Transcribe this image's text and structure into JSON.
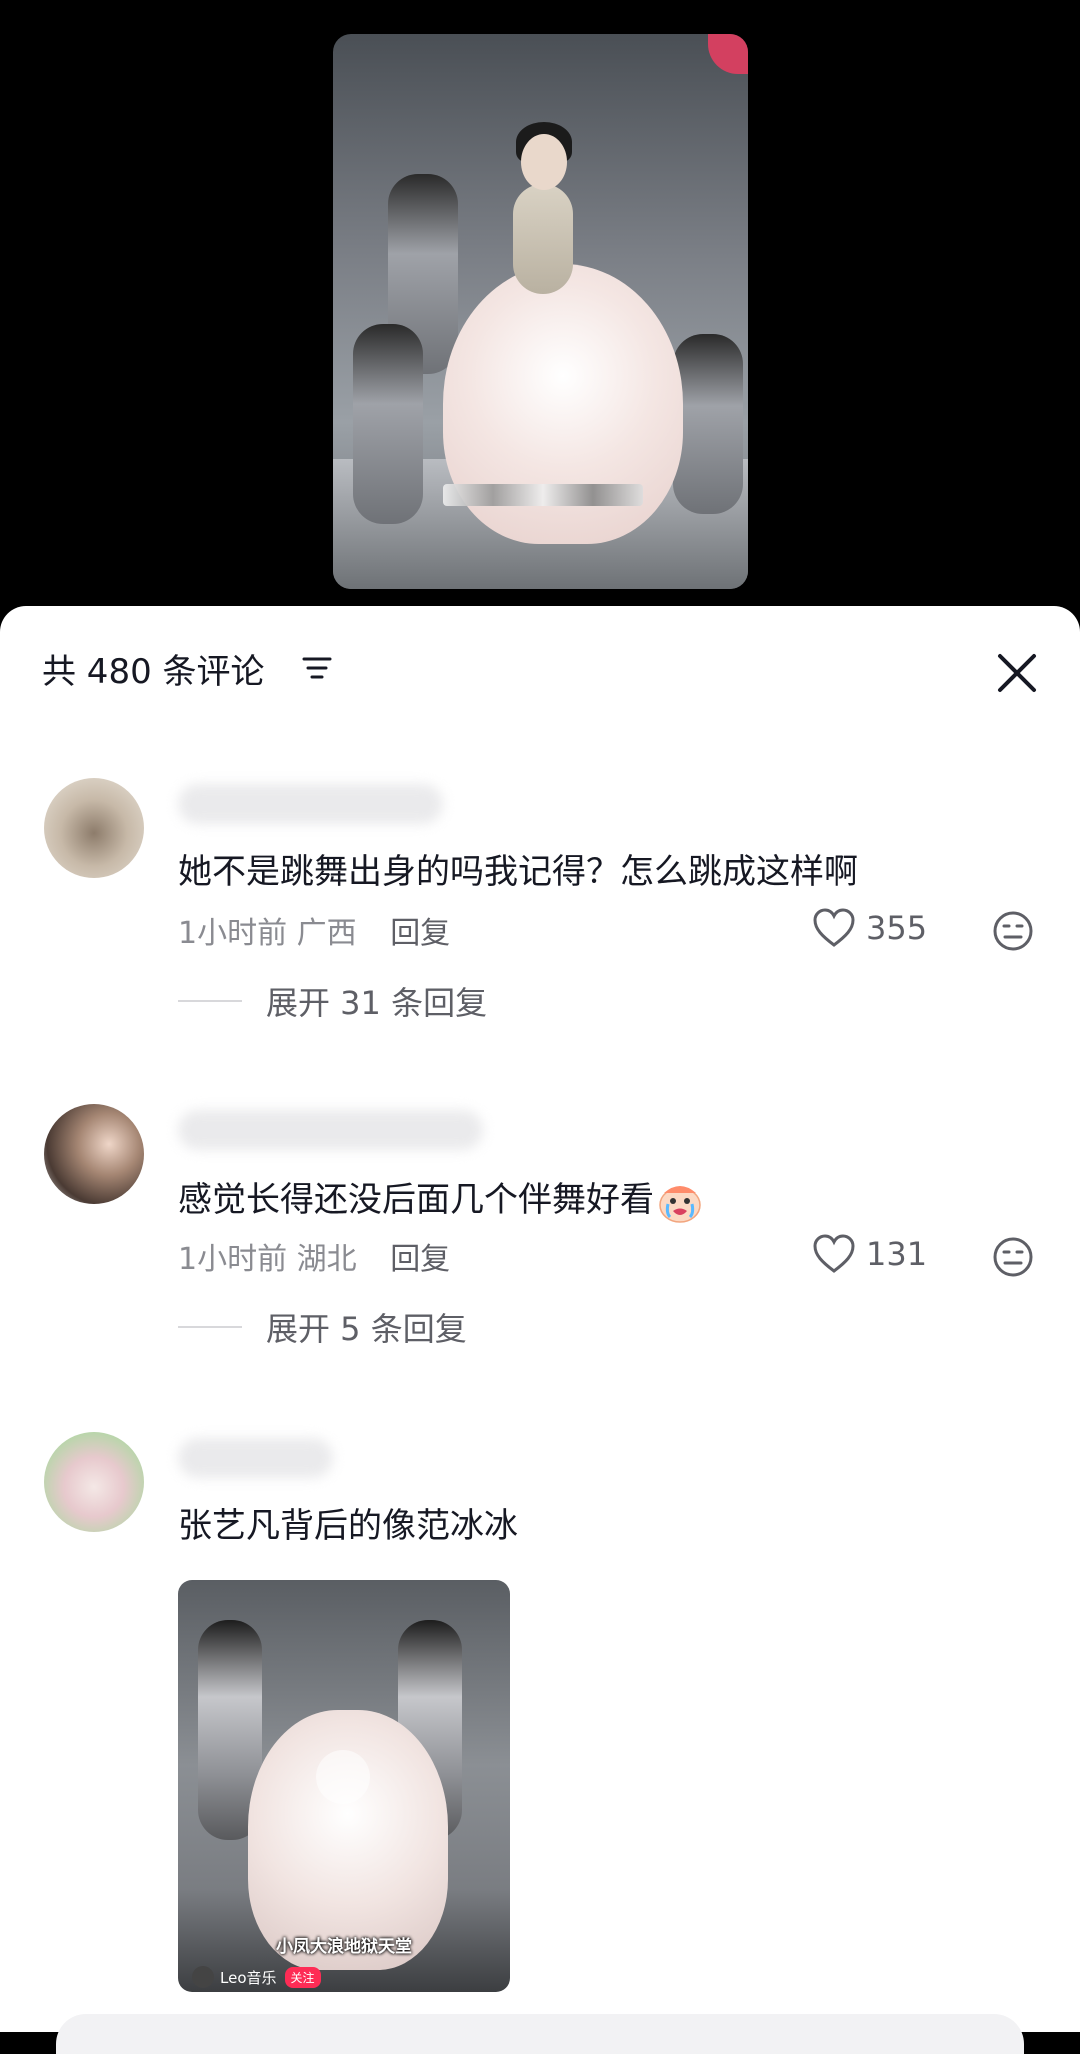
{
  "header": {
    "comment_count_label": "共 480 条评论"
  },
  "comments": [
    {
      "text": "她不是跳舞出身的吗我记得？怎么跳成这样啊",
      "time": "1小时前",
      "location": "广西",
      "reply_label": "回复",
      "likes": "355",
      "expand_label": "展开 31 条回复"
    },
    {
      "text": "感觉长得还没后面几个伴舞好看",
      "emoji": "crying-face",
      "time": "1小时前",
      "location": "湖北",
      "reply_label": "回复",
      "likes": "131",
      "expand_label": "展开 5 条回复"
    },
    {
      "text": "张艺凡背后的像范冰冰",
      "image": {
        "caption": "小凤大浪地狱天堂",
        "author": "Leo音乐",
        "follow_label": "关注"
      }
    }
  ],
  "colors": {
    "accent": "#fe2c55",
    "text_primary": "#161823",
    "text_secondary": "#8a8b91"
  }
}
